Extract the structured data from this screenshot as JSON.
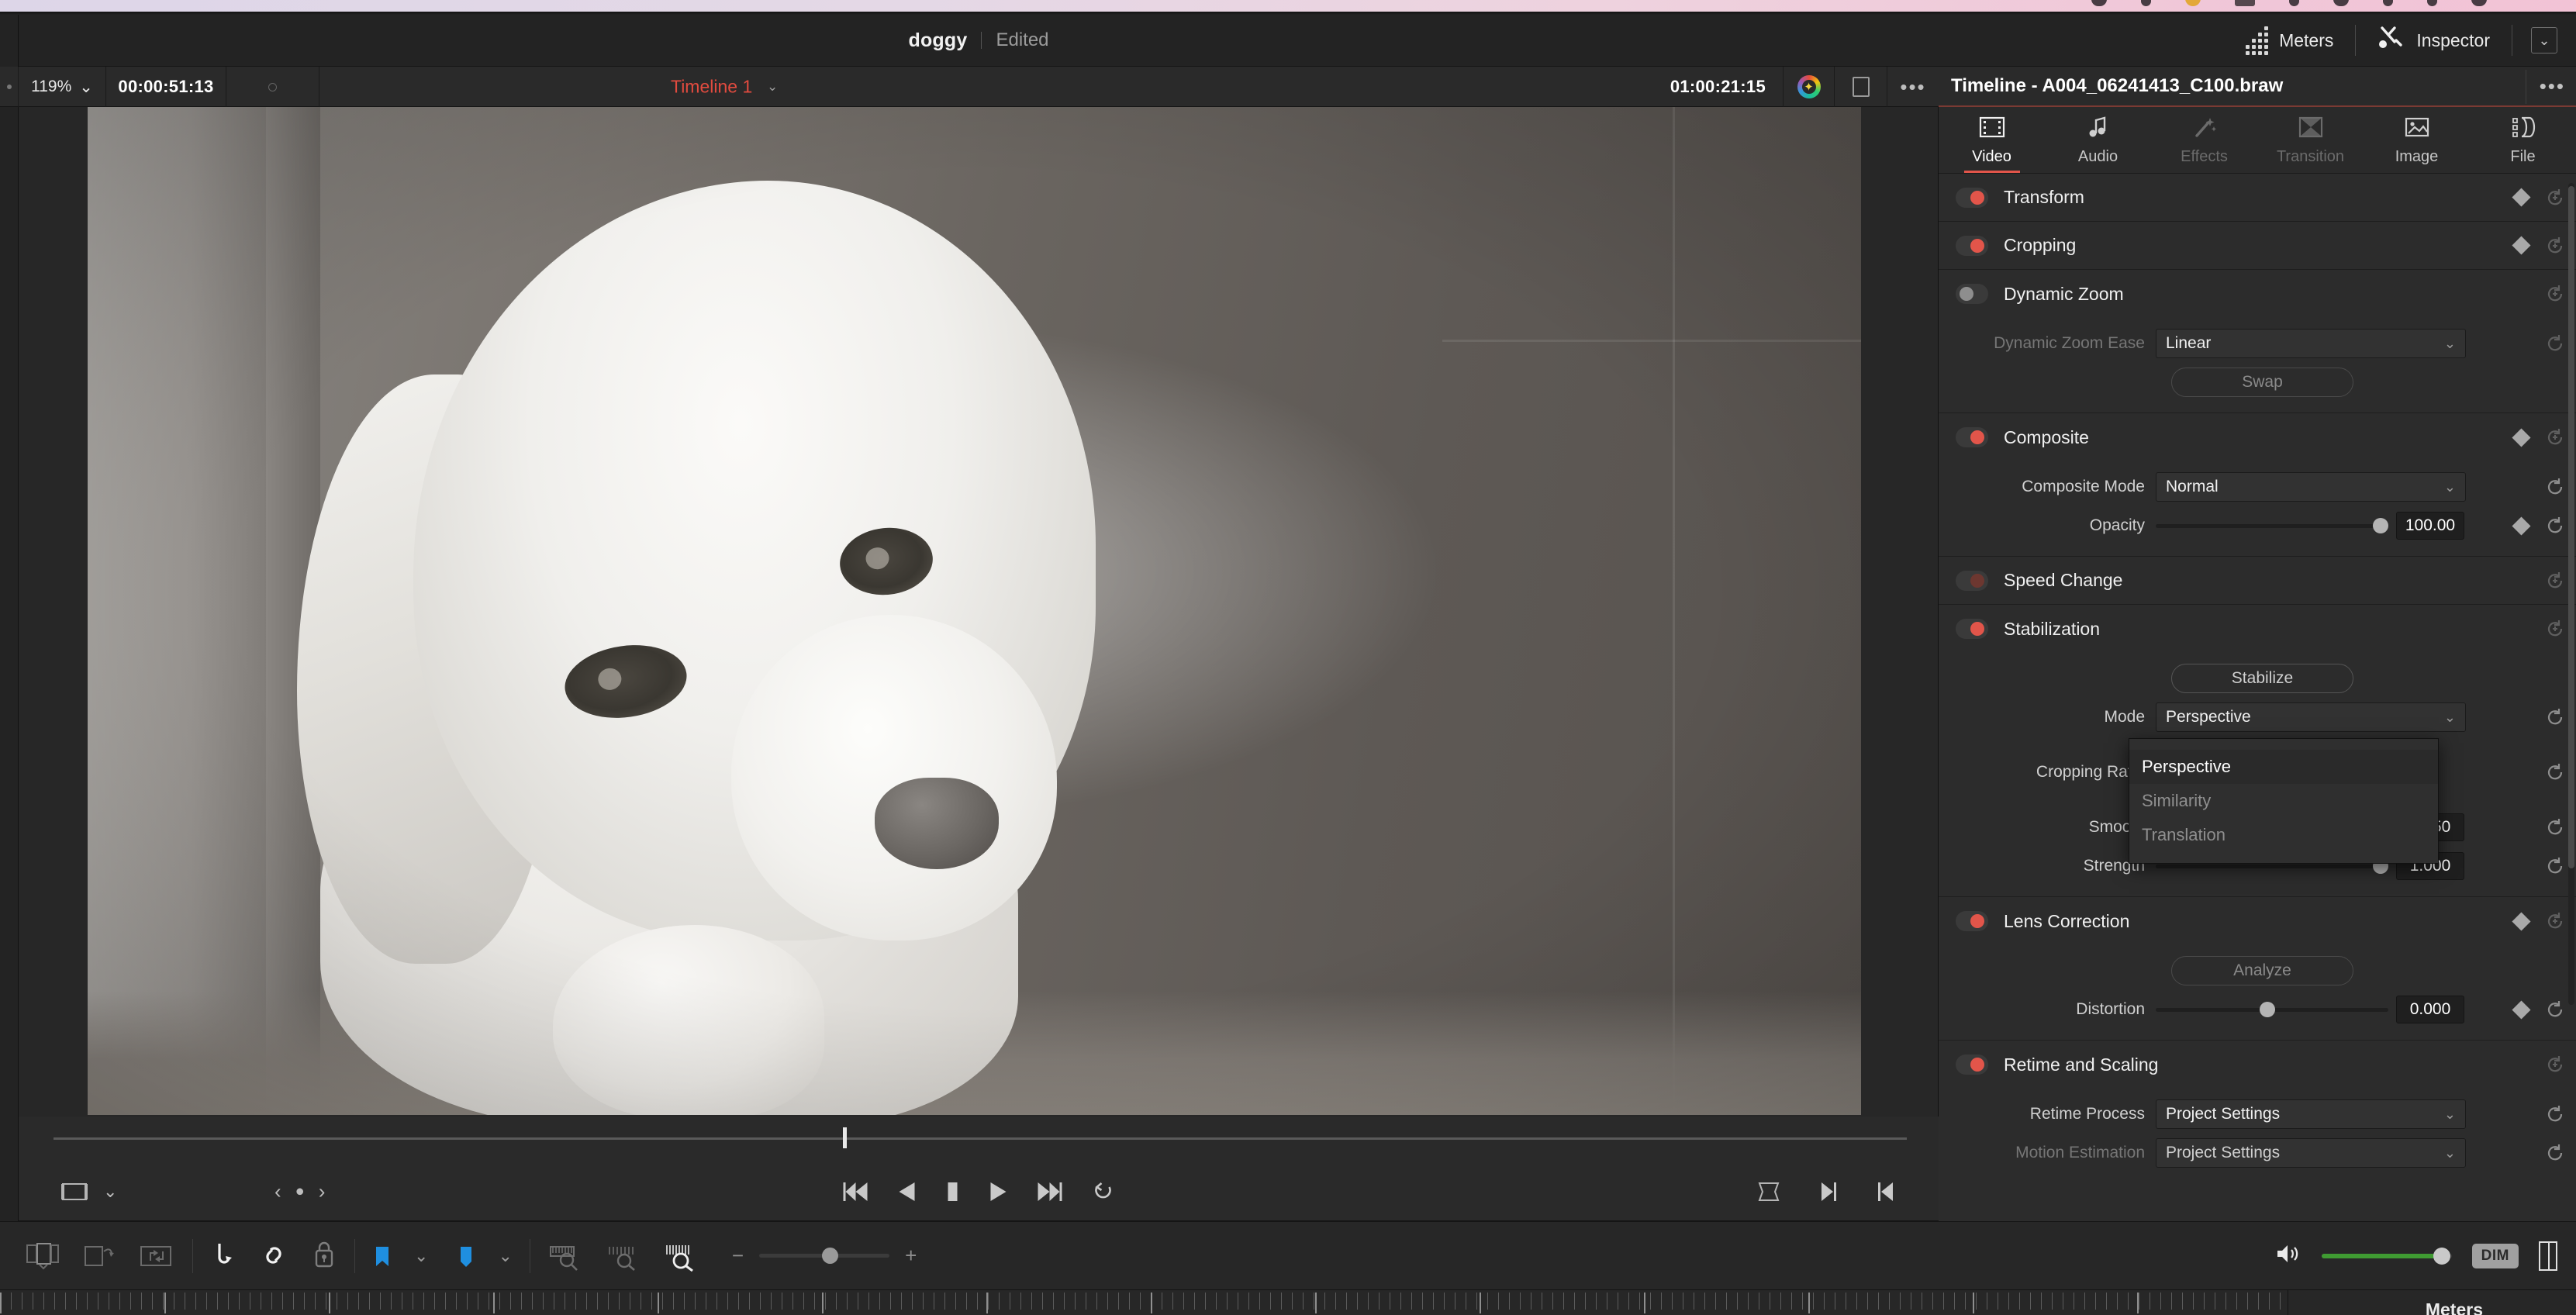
{
  "macbar": {
    "icons": [
      "vpn-icon",
      "dropbox-icon",
      "wifi-icon",
      "battery-icon",
      "bluetooth-icon",
      "audio-icon",
      "display-icon",
      "time-machine-icon",
      "user-icon"
    ]
  },
  "viewer": {
    "clip_name": "doggy",
    "clip_state": "Edited",
    "zoom_level": "119%",
    "source_timecode": "00:00:51:13",
    "timeline_name": "Timeline 1",
    "record_timecode": "01:00:21:15",
    "color_wheel_icon": "color-page-icon",
    "safe_area_icon": "frame-icon",
    "options_icon": "ellipsis-icon",
    "transport": {
      "jump_start_icon": "skip-to-start-icon",
      "reverse_icon": "play-reverse-icon",
      "stop_icon": "stop-icon",
      "play_icon": "play-icon",
      "jump_end_icon": "skip-to-end-icon",
      "loop_icon": "loop-icon",
      "annotation_icon": "annotation-icon",
      "marker_prev_icon": "prev-marker-icon",
      "marker_dot_icon": "marker-icon",
      "marker_next_icon": "next-marker-icon",
      "fit_icon": "fit-screen-icon",
      "in_icon": "mark-in-icon",
      "out_icon": "mark-out-icon"
    }
  },
  "bottom_toolbar": {
    "tools": [
      {
        "name": "insert-clip-icon",
        "state": "dim"
      },
      {
        "name": "overwrite-clip-icon",
        "state": "dim"
      },
      {
        "name": "replace-clip-icon",
        "state": "dim"
      },
      {
        "name": "snapping-icon",
        "state": "on"
      },
      {
        "name": "linked-selection-icon",
        "state": "on"
      },
      {
        "name": "flag-lock-icon",
        "state": "dim"
      },
      {
        "name": "flag-icon",
        "state": "blue"
      },
      {
        "name": "marker-icon",
        "state": "blue"
      },
      {
        "name": "zoom-to-fit-icon",
        "state": "dim"
      },
      {
        "name": "zoom-detail-icon",
        "state": "dim"
      },
      {
        "name": "zoom-custom-icon",
        "state": "on"
      }
    ],
    "zoom_minus": "−",
    "zoom_plus": "+",
    "volume_icon": "speaker-icon",
    "dim_label": "DIM",
    "split_icon": "split-view-icon",
    "meters_label": "Meters"
  },
  "inspector_header": {
    "meters_label": "Meters",
    "meters_icon": "meters-icon",
    "inspector_label": "Inspector",
    "inspector_icon": "inspector-icon",
    "collapse_icon": "chevron-down-icon"
  },
  "inspector": {
    "clip_title": "Timeline - A004_06241413_C100.braw",
    "options_icon": "ellipsis-icon",
    "tabs": [
      {
        "label": "Video",
        "icon": "film-strip-icon",
        "state": "active"
      },
      {
        "label": "Audio",
        "icon": "music-note-icon",
        "state": "normal"
      },
      {
        "label": "Effects",
        "icon": "magic-wand-icon",
        "state": "disabled"
      },
      {
        "label": "Transition",
        "icon": "transition-icon",
        "state": "disabled"
      },
      {
        "label": "Image",
        "icon": "image-icon",
        "state": "normal"
      },
      {
        "label": "File",
        "icon": "file-stack-icon",
        "state": "normal"
      }
    ],
    "sections": [
      {
        "id": "transform",
        "title": "Transform",
        "toggle": "on",
        "keyframe": true,
        "reset_enabled": false
      },
      {
        "id": "cropping",
        "title": "Cropping",
        "toggle": "on",
        "keyframe": true,
        "reset_enabled": false
      },
      {
        "id": "dynamic_zoom",
        "title": "Dynamic Zoom",
        "toggle": "off",
        "keyframe": false,
        "reset_enabled": false
      },
      {
        "id": "composite",
        "title": "Composite",
        "toggle": "on",
        "keyframe": true,
        "reset_enabled": false
      },
      {
        "id": "speed_change",
        "title": "Speed Change",
        "toggle": "dimred",
        "keyframe": false,
        "reset_enabled": false
      },
      {
        "id": "stabilization",
        "title": "Stabilization",
        "toggle": "on",
        "keyframe": false,
        "reset_enabled": false
      },
      {
        "id": "lens_correction",
        "title": "Lens Correction",
        "toggle": "on",
        "keyframe": true,
        "reset_enabled": false
      },
      {
        "id": "retime_scaling",
        "title": "Retime and Scaling",
        "toggle": "on",
        "keyframe": false,
        "reset_enabled": false
      }
    ],
    "dynamic_zoom": {
      "ease_label": "Dynamic Zoom Ease",
      "ease_value": "Linear",
      "swap_label": "Swap"
    },
    "composite": {
      "mode_label": "Composite Mode",
      "mode_value": "Normal",
      "opacity_label": "Opacity",
      "opacity_value": "100.00"
    },
    "stabilization": {
      "stabilize_label": "Stabilize",
      "mode_label": "Mode",
      "mode_value": "Perspective",
      "mode_options": [
        "Perspective",
        "Similarity",
        "Translation"
      ],
      "mode_selected": "Perspective",
      "cropping_ratio_label": "Cropping Ratio",
      "smooth_label": "Smooth",
      "smooth_value": "0.250",
      "strength_label": "Strength",
      "strength_value": "1.000"
    },
    "lens_correction": {
      "analyze_label": "Analyze",
      "distortion_label": "Distortion",
      "distortion_value": "0.000"
    },
    "retime_scaling": {
      "retime_process_label": "Retime Process",
      "retime_process_value": "Project Settings",
      "motion_estimation_label": "Motion Estimation",
      "motion_estimation_value": "Project Settings"
    }
  },
  "colors": {
    "accent_red": "#e2554a",
    "timeline_red": "#e24b3f",
    "toggle_on": "#e2554a",
    "volume_green": "#3f9b32",
    "marker_blue": "#1f8fe0",
    "panel_bg": "#2c2c2c"
  }
}
